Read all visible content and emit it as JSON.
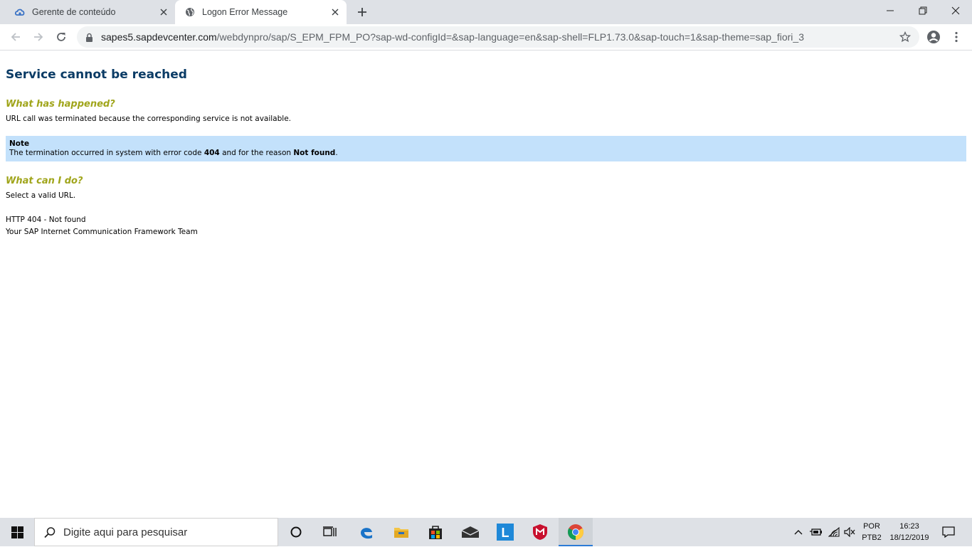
{
  "browser": {
    "tabs": [
      {
        "title": "Gerente de conteúdo",
        "favicon": "cloud-icon"
      },
      {
        "title": "Logon Error Message",
        "favicon": "globe-icon",
        "active": true
      }
    ],
    "url_host": "sapes5.sapdevcenter.com",
    "url_path": "/webdynpro/sap/S_EPM_FPM_PO?sap-wd-configId=&sap-language=en&sap-shell=FLP1.73.0&sap-touch=1&sap-theme=sap_fiori_3"
  },
  "page": {
    "title": "Service cannot be reached",
    "what_happened_heading": "What has happened?",
    "what_happened_text": "URL call was terminated because the corresponding service is not available.",
    "note": {
      "title": "Note",
      "text_before_code": "The termination occurred in system with error code ",
      "error_code": "404",
      "text_before_reason": " and for the reason ",
      "reason": "Not found",
      "text_after": "."
    },
    "what_can_i_do_heading": "What can I do?",
    "what_can_i_do_text": "Select a valid URL.",
    "http_status": "HTTP 404 - Not found",
    "team": "Your SAP Internet Communication Framework Team"
  },
  "taskbar": {
    "search_placeholder": "Digite aqui para pesquisar",
    "language_line1": "POR",
    "language_line2": "PTB2",
    "time": "16:23",
    "date": "18/12/2019",
    "l_app_letter": "L"
  },
  "colors": {
    "title": "#0b3c66",
    "heading": "#a0a51b",
    "note_bg": "#c3e1fb",
    "chrome_frame": "#dee1e6"
  }
}
